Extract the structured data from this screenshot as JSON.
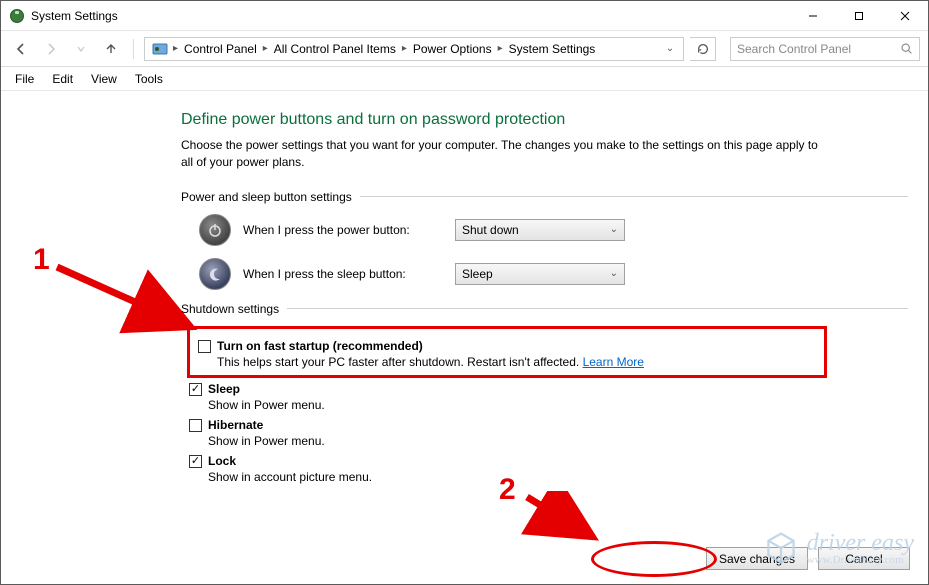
{
  "window": {
    "title": "System Settings"
  },
  "breadcrumb": {
    "items": [
      "Control Panel",
      "All Control Panel Items",
      "Power Options",
      "System Settings"
    ]
  },
  "search": {
    "placeholder": "Search Control Panel"
  },
  "menu": {
    "items": [
      "File",
      "Edit",
      "View",
      "Tools"
    ]
  },
  "page": {
    "heading": "Define power buttons and turn on password protection",
    "subtext": "Choose the power settings that you want for your computer. The changes you make to the settings on this page apply to all of your power plans."
  },
  "power_sleep": {
    "group_label": "Power and sleep button settings",
    "power_button_label": "When I press the power button:",
    "power_button_value": "Shut down",
    "sleep_button_label": "When I press the sleep button:",
    "sleep_button_value": "Sleep"
  },
  "shutdown": {
    "group_label": "Shutdown settings",
    "fast_startup": {
      "label": "Turn on fast startup (recommended)",
      "desc_prefix": "This helps start your PC faster after shutdown. Restart isn't affected. ",
      "learn_more": "Learn More",
      "checked": false
    },
    "sleep": {
      "label": "Sleep",
      "desc": "Show in Power menu.",
      "checked": true
    },
    "hibernate": {
      "label": "Hibernate",
      "desc": "Show in Power menu.",
      "checked": false
    },
    "lock": {
      "label": "Lock",
      "desc": "Show in account picture menu.",
      "checked": true
    }
  },
  "buttons": {
    "save": "Save changes",
    "cancel": "Cancel"
  },
  "annotations": {
    "one": "1",
    "two": "2"
  },
  "watermark": {
    "brand": "driver easy",
    "url": "www.DriverEasy.com"
  }
}
